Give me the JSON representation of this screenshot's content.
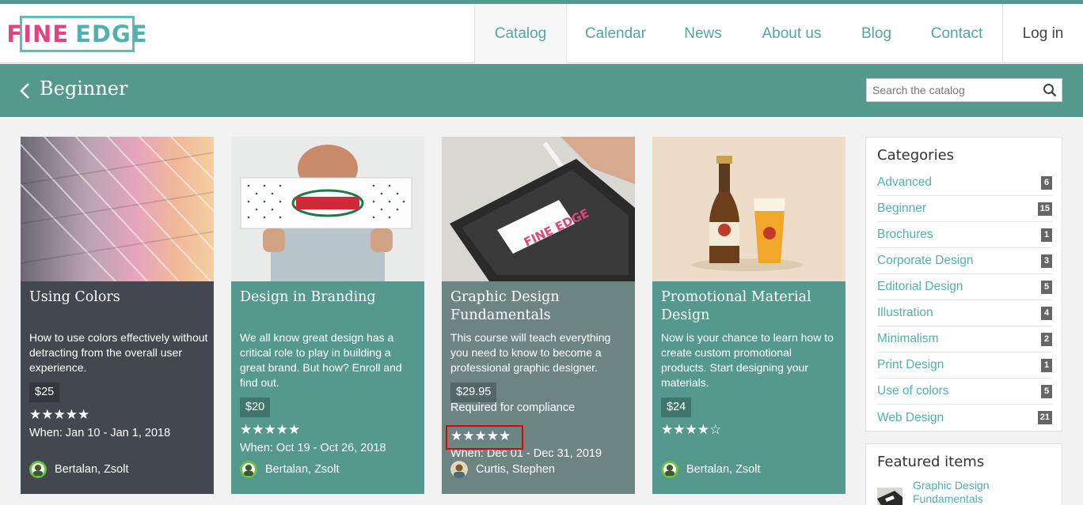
{
  "brand": {
    "word1": "FINE",
    "word2": "EDGE",
    "accent_teal": "#54988e",
    "accent_pink": "#e0447e"
  },
  "nav": {
    "items": [
      "Catalog",
      "Calendar",
      "News",
      "About us",
      "Blog",
      "Contact"
    ],
    "login": "Log in"
  },
  "band": {
    "title": "Beginner",
    "search_placeholder": "Search the catalog"
  },
  "cards": [
    {
      "title": "Using Colors",
      "desc": "How to use colors effectively without detracting from the overall user experience.",
      "price": "$25",
      "stars": "★★★★★",
      "when": "When: Jan 10 - Jan 1, 2018",
      "author": "Bertalan, Zsolt",
      "rating": 5,
      "bg": "#434850"
    },
    {
      "title": "Design in Branding",
      "desc": "We all know great design has a critical role to play in building a great brand. But how? Enroll and find out.",
      "price": "$20",
      "stars": "★★★★★",
      "when": "When: Oct 19 - Oct 26, 2018",
      "author": "Bertalan, Zsolt",
      "rating": 5,
      "bg": "#54988e"
    },
    {
      "title": "Graphic Design Fundamentals",
      "desc": "This course will teach everything you need to know to become a professional graphic designer.",
      "price": "$29.95",
      "required": "Required for compliance",
      "stars": "★★★★★",
      "when": "When: Dec 01 - Dec 31, 2019",
      "author": "Curtis, Stephen",
      "rating": 5,
      "bg": "#6c8583"
    },
    {
      "title": "Promotional Material Design",
      "desc": "Now is your chance to learn how to create custom promotional products. Start designing your materials.",
      "price": "$24",
      "stars": "★★★★☆",
      "author": "Bertalan, Zsolt",
      "rating": 4,
      "bg": "#54988e"
    }
  ],
  "categories": {
    "heading": "Categories",
    "items": [
      {
        "label": "Advanced",
        "count": "6"
      },
      {
        "label": "Beginner",
        "count": "15"
      },
      {
        "label": "Brochures",
        "count": "1"
      },
      {
        "label": "Corporate Design",
        "count": "3"
      },
      {
        "label": "Editorial Design",
        "count": "5"
      },
      {
        "label": "Illustration",
        "count": "4"
      },
      {
        "label": "Minimalism",
        "count": "2"
      },
      {
        "label": "Print Design",
        "count": "1"
      },
      {
        "label": "Use of colors",
        "count": "5"
      },
      {
        "label": "Web Design",
        "count": "21"
      }
    ]
  },
  "featured": {
    "heading": "Featured items",
    "item": "Graphic Design Fundamentals"
  },
  "icons": [
    "back-chevron-icon",
    "search-icon",
    "star-icon",
    "avatar-icon"
  ]
}
